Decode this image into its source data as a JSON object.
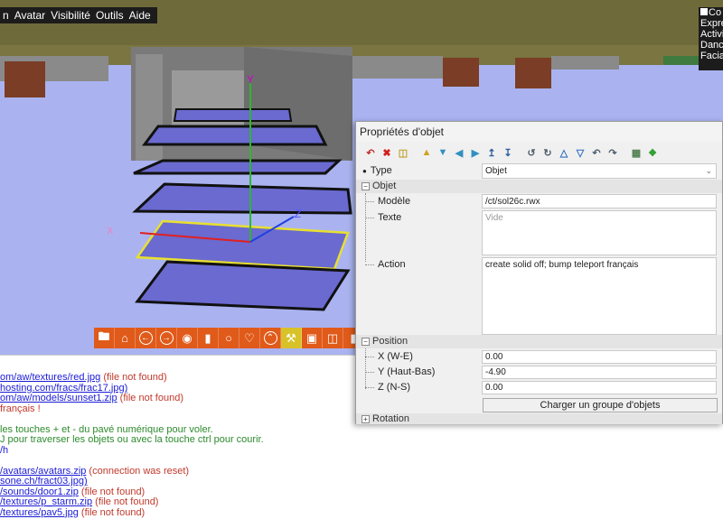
{
  "menubar": {
    "items": [
      "n",
      "Avatar",
      "Visibilité",
      "Outils",
      "Aide"
    ]
  },
  "rightpanel": {
    "lines": [
      "Co",
      "Expre",
      "Activi",
      "Danc",
      "Facia"
    ]
  },
  "toolbar": {
    "icons": [
      "folder-icon",
      "home-icon",
      "back-arrow-icon",
      "forward-arrow-icon",
      "eye-icon",
      "camera-video-icon",
      "chat-bubble-icon",
      "heart-icon",
      "up-arrow-icon",
      "build-icon",
      "photo-camera-icon",
      "map-icon",
      "more-icon"
    ]
  },
  "properties": {
    "title": "Propriétés d'objet",
    "type_label": "Type",
    "type_value": "Objet",
    "section_object": "Objet",
    "model_label": "Modèle",
    "model_value": "/ct/sol26c.rwx",
    "text_label": "Texte",
    "text_placeholder": "Vide",
    "action_label": "Action",
    "action_value": "create solid off; bump teleport français",
    "section_position": "Position",
    "x_label": "X (W-E)",
    "x_value": "0.00",
    "y_label": "Y (Haut-Bas)",
    "y_value": "-4.90",
    "z_label": "Z (N-S)",
    "z_value": "0.00",
    "load_group_label": "Charger un groupe d'objets",
    "section_rotation": "Rotation"
  },
  "chatlog": {
    "lines": [
      {
        "url": "om/aw/textures/red.jpg",
        "msg": " (file not found)",
        "kind": "err"
      },
      {
        "url": "hosting.com/fracs/frac17.jpg)",
        "msg": "",
        "kind": "url"
      },
      {
        "url": "om/aw/models/sunset1.zip",
        "msg": " (file not found)",
        "kind": "err"
      },
      {
        "url": "",
        "msg": "français !",
        "kind": "orange"
      },
      {
        "url": "",
        "msg": "",
        "kind": "blank"
      },
      {
        "url": "",
        "msg": "les touches + et - du pavé numérique pour voler.",
        "kind": "green"
      },
      {
        "url": "",
        "msg": "J pour traverser les objets ou avec la touche ctrl pour courir.",
        "kind": "green"
      },
      {
        "url": "",
        "msg": "/h",
        "kind": "blue"
      },
      {
        "url": "",
        "msg": "",
        "kind": "blank"
      },
      {
        "url": "/avatars/avatars.zip",
        "msg": " (connection was reset)",
        "kind": "err"
      },
      {
        "url": "sone.ch/fract03.jpg)",
        "msg": "",
        "kind": "url"
      },
      {
        "url": "/sounds/door1.zip",
        "msg": " (file not found)",
        "kind": "err"
      },
      {
        "url": "/textures/p_starm.zip",
        "msg": " (file not found)",
        "kind": "err"
      },
      {
        "url": "/textures/pav5.jpg",
        "msg": " (file not found)",
        "kind": "err"
      }
    ]
  },
  "colors": {
    "sky": "#aab3f0",
    "toolbar_orange": "#e05a1a",
    "toolbar_yellow": "#d8c229",
    "link_blue": "#1a1ad6",
    "error_red": "#c0392b",
    "info_green": "#2d8a2d"
  }
}
